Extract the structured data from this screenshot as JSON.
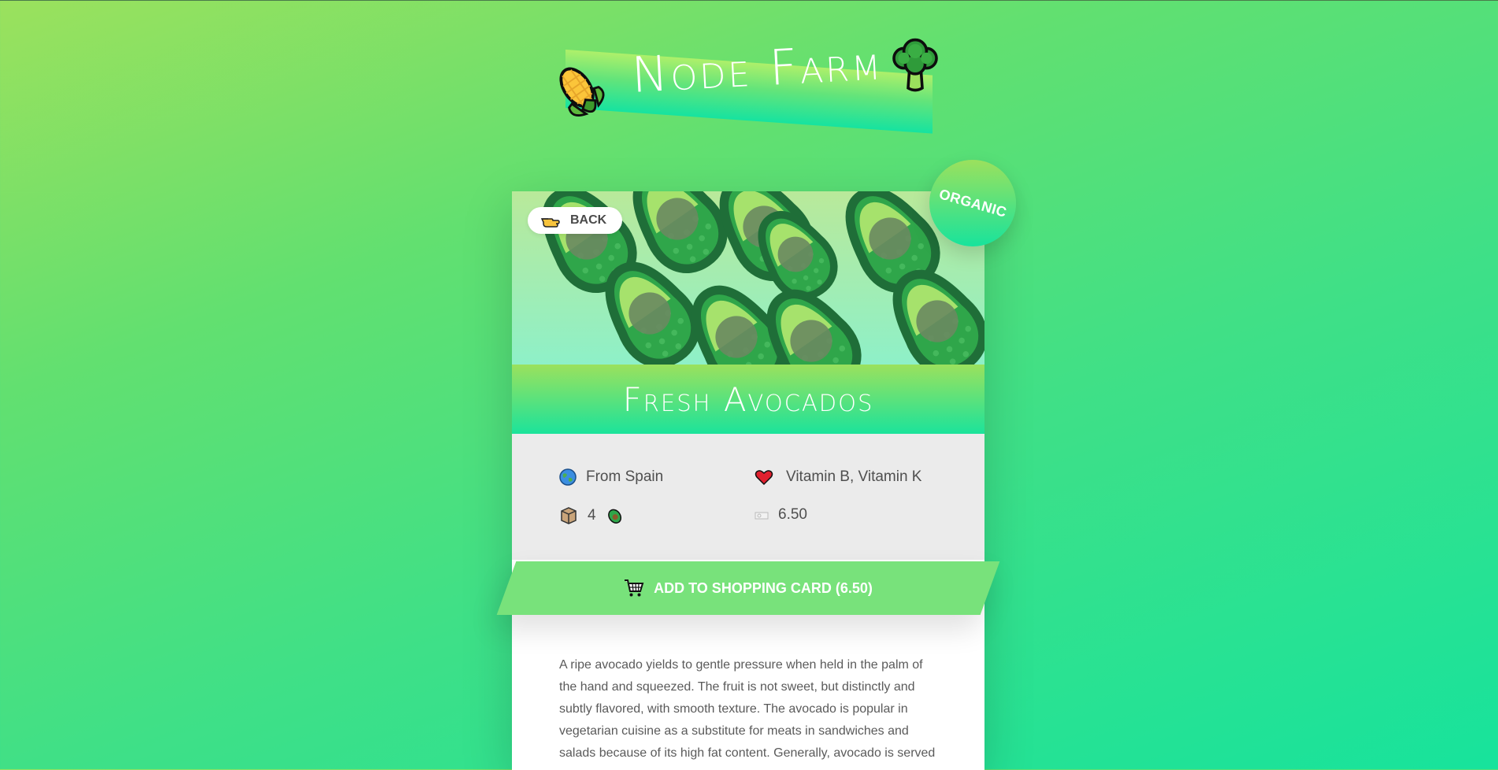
{
  "header": {
    "title": "Node Farm",
    "left_icon": "corn-icon",
    "right_icon": "broccoli-icon"
  },
  "product": {
    "back_label": "BACK",
    "badge": "ORGANIC",
    "name": "Fresh Avocados",
    "from": "From Spain",
    "nutrients": "Vitamin B, Vitamin K",
    "quantity": "4",
    "price": "6.50",
    "add_button_label": "ADD TO SHOPPING CARD (6.50)",
    "description": "A ripe avocado yields to gentle pressure when held in the palm of the hand and squeezed. The fruit is not sweet, but distinctly and subtly flavored, with smooth texture. The avocado is popular in vegetarian cuisine as a substitute for meats in sandwiches and salads because of its high fat content. Generally, avocado is served"
  },
  "colors": {
    "accent": "#78e27b",
    "gradient_start": "#9be15d",
    "gradient_end": "#18e39c",
    "details_bg": "#ebebeb",
    "text": "#4f4f4f"
  }
}
